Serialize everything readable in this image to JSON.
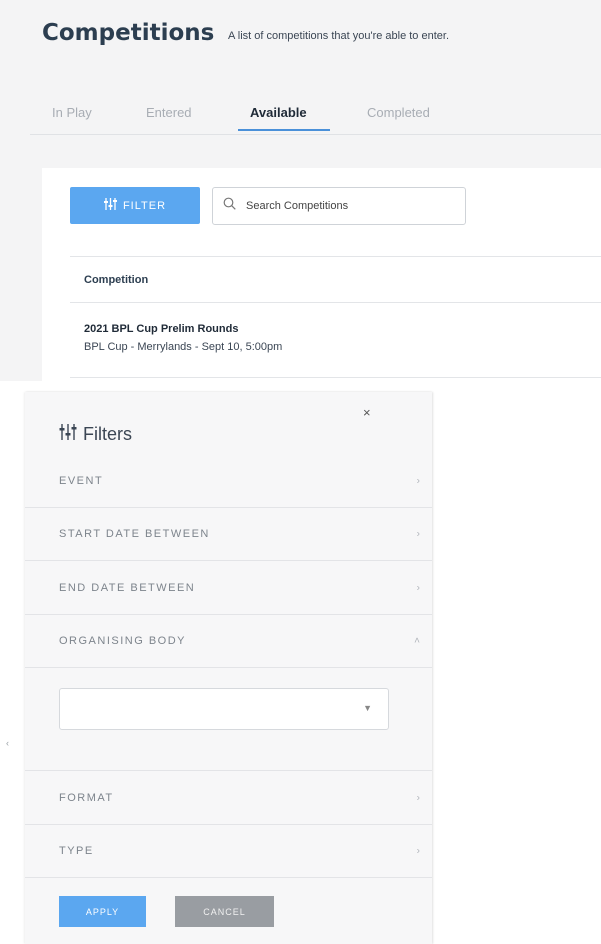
{
  "header": {
    "title": "Competitions",
    "subtitle": "A list of competitions that you're able to enter."
  },
  "tabs": [
    {
      "label": "In Play",
      "active": false
    },
    {
      "label": "Entered",
      "active": false
    },
    {
      "label": "Available",
      "active": true
    },
    {
      "label": "Completed",
      "active": false
    }
  ],
  "toolbar": {
    "filter_label": "FILTER",
    "search_placeholder": "Search Competitions"
  },
  "table": {
    "column_header": "Competition",
    "rows": [
      {
        "title": "2021 BPL Cup Prelim Rounds",
        "subtitle": "BPL Cup - Merrylands - Sept 10, 5:00pm"
      }
    ]
  },
  "filters_drawer": {
    "title": "Filters",
    "close_glyph": "×",
    "sections": [
      {
        "label": "EVENT",
        "expanded": false
      },
      {
        "label": "START DATE BETWEEN",
        "expanded": false
      },
      {
        "label": "END DATE BETWEEN",
        "expanded": false
      },
      {
        "label": "ORGANISING BODY",
        "expanded": true
      },
      {
        "label": "FORMAT",
        "expanded": false
      },
      {
        "label": "TYPE",
        "expanded": false
      }
    ],
    "organising_body_value": "",
    "apply_label": "APPLY",
    "cancel_label": "CANCEL"
  },
  "icons": {
    "filter": "sliders-icon",
    "search": "search-icon",
    "close": "close-icon",
    "chevron_right": "chevron-right-icon",
    "chevron_up": "chevron-up-icon",
    "dropdown": "caret-down-icon"
  },
  "colors": {
    "primary": "#5ba7f0",
    "tab_underline": "#4a90d9",
    "cancel": "#999da2",
    "title": "#2c3e50"
  }
}
